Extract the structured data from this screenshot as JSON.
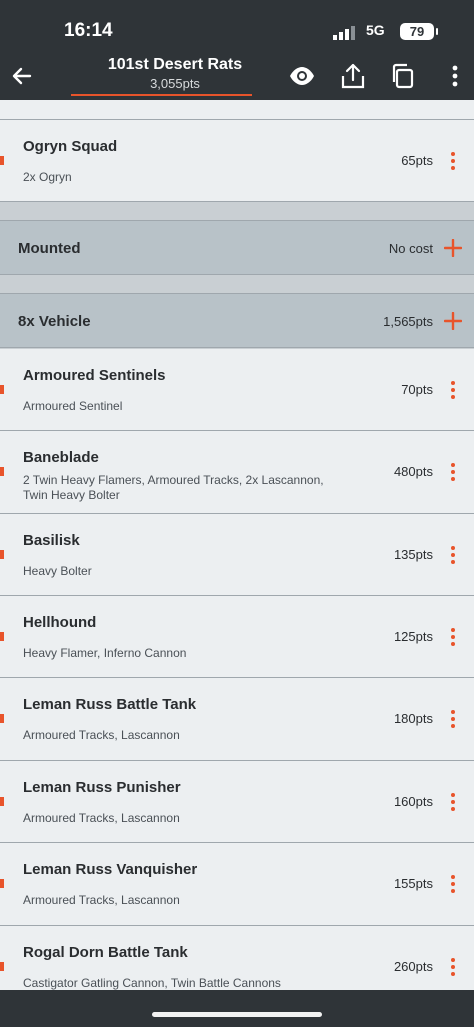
{
  "status_bar": {
    "time": "16:14",
    "network": "5G",
    "battery": "79"
  },
  "app_bar": {
    "title": "101st Desert Rats",
    "subtitle": "3,055pts",
    "accent_color": "#e8542b",
    "icons": [
      "back-arrow-icon",
      "eye-icon",
      "share-icon",
      "copy-icon",
      "more-vertical-icon"
    ]
  },
  "top_units": [
    {
      "name": "Ogryn Squad",
      "desc": "2x Ogryn",
      "pts": "65pts"
    }
  ],
  "sections": [
    {
      "label": "Mounted",
      "cost": "No cost"
    },
    {
      "label": "8x Vehicle",
      "cost": "1,565pts"
    }
  ],
  "vehicles": [
    {
      "name": "Armoured Sentinels",
      "desc": "Armoured Sentinel",
      "pts": "70pts"
    },
    {
      "name": "Baneblade",
      "desc": "2 Twin Heavy Flamers, Armoured Tracks, 2x Lascannon, Twin Heavy Bolter",
      "pts": "480pts"
    },
    {
      "name": "Basilisk",
      "desc": "Heavy Bolter",
      "pts": "135pts"
    },
    {
      "name": "Hellhound",
      "desc": "Heavy Flamer, Inferno Cannon",
      "pts": "125pts"
    },
    {
      "name": "Leman Russ Battle Tank",
      "desc": "Armoured Tracks, Lascannon",
      "pts": "180pts"
    },
    {
      "name": "Leman Russ Punisher",
      "desc": "Armoured Tracks, Lascannon",
      "pts": "160pts"
    },
    {
      "name": "Leman Russ Vanquisher",
      "desc": "Armoured Tracks, Lascannon",
      "pts": "155pts"
    },
    {
      "name": "Rogal Dorn Battle Tank",
      "desc": "Castigator Gatling Cannon, Twin Battle Cannons",
      "pts": "260pts"
    }
  ]
}
